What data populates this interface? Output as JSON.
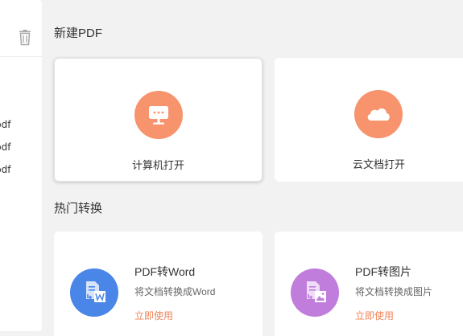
{
  "recent_files": [
    {
      "name": "pdf"
    },
    {
      "name": "pdf"
    },
    {
      "name": "pdf"
    }
  ],
  "icons": {
    "trash": "trash-icon",
    "computer": "monitor-icon",
    "cloud": "cloud-icon",
    "word": "pdf-to-word-icon",
    "image": "pdf-to-image-icon"
  },
  "colors": {
    "accent_orange": "#f7936d",
    "link_orange": "#f08458",
    "word_blue": "#4a86e8",
    "image_purple": "#c07ddc"
  },
  "new_pdf": {
    "title": "新建PDF",
    "cards": [
      {
        "label": "计算机打开"
      },
      {
        "label": "云文档打开"
      }
    ]
  },
  "hot_convert": {
    "title": "热门转换",
    "cards": [
      {
        "title": "PDF转Word",
        "desc": "将文档转换成Word",
        "action": "立即使用"
      },
      {
        "title": "PDF转图片",
        "desc": "将文档转换成图片",
        "action": "立即使用"
      }
    ]
  }
}
